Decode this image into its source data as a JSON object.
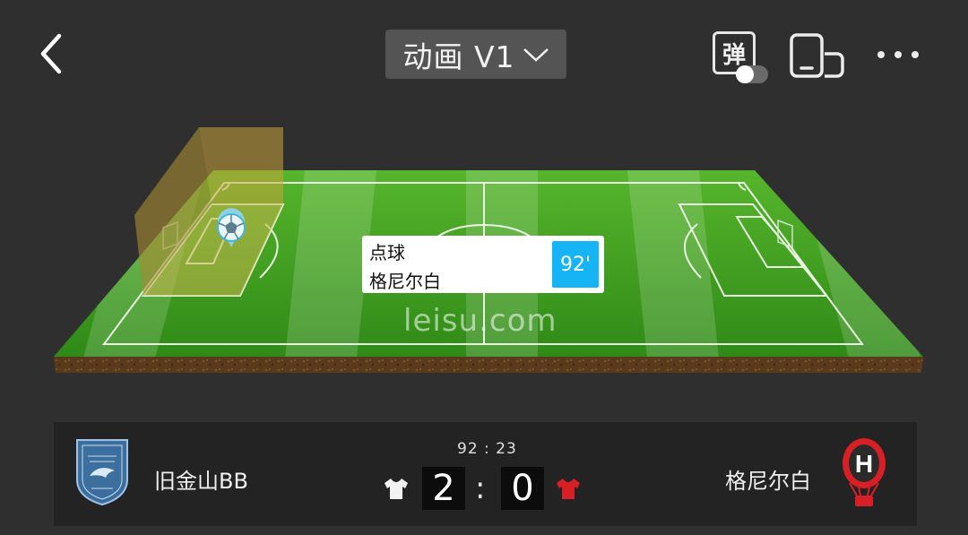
{
  "header": {
    "title": "动画 V1",
    "danmaku_label": "弹"
  },
  "icons": {
    "back": "back-arrow-icon",
    "dropdown": "chevron-down-icon",
    "danmaku": "danmaku-toggle-icon",
    "device": "device-rotate-icon",
    "more": "more-dots-icon",
    "ball": "soccer-ball-icon"
  },
  "event": {
    "type": "点球",
    "team": "格尼尔白",
    "minute": "92'"
  },
  "watermark": "leisu.com",
  "match": {
    "clock": "92 : 23",
    "home": {
      "name": "旧金山BB",
      "score": "2",
      "shirt_color": "#f2f2f2"
    },
    "away": {
      "name": "格尼尔白",
      "score": "0",
      "shirt_color": "#d81f26"
    },
    "separator": ":"
  },
  "colors": {
    "background": "#2f2f2f",
    "pitch_green": "#3f9e22",
    "minute_badge": "#17b4f5",
    "highlight_zone": "#b59a3a"
  }
}
